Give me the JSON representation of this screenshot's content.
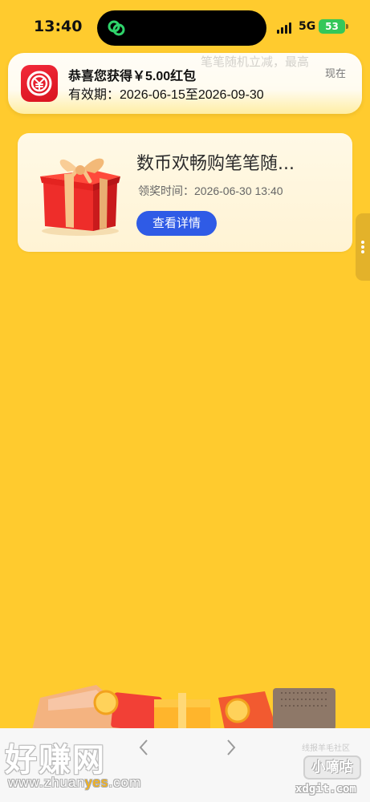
{
  "status_bar": {
    "time": "13:40",
    "network": "5G",
    "battery": "53"
  },
  "notification": {
    "title": "恭喜您获得￥5.00红包",
    "body": "有效期：2026-06-15至2026-09-30",
    "time": "现在",
    "background_text": "笔笔随机立减，最高"
  },
  "reward_card": {
    "title": "数币欢畅购笔笔随...",
    "claim_time": "领奖时间：2026-06-30 13:40",
    "button_label": "查看详情"
  },
  "watermark": {
    "brand": "好赚网",
    "url_prefix": "www.zhuan",
    "url_highlight": "yes",
    "url_suffix": ".com",
    "community_label": "线报羊毛社区",
    "community_name": "小嘀咕",
    "community_url": "xdgit.com"
  },
  "colors": {
    "background": "#FFCB2E",
    "button": "#2F5BE6",
    "app_icon": "#E51C2A",
    "battery": "#34C759"
  },
  "icons": {
    "island": "link-chain-icon",
    "app": "digital-yuan-icon",
    "gift": "gift-box-icon",
    "nav_prev": "chevron-left-icon",
    "nav_next": "chevron-right-icon"
  }
}
